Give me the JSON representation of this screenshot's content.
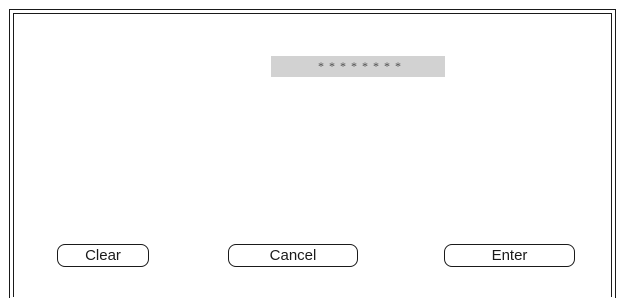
{
  "password_field": {
    "value": "* * * * * * * *"
  },
  "buttons": {
    "clear_label": "Clear",
    "cancel_label": "Cancel",
    "enter_label": "Enter"
  }
}
